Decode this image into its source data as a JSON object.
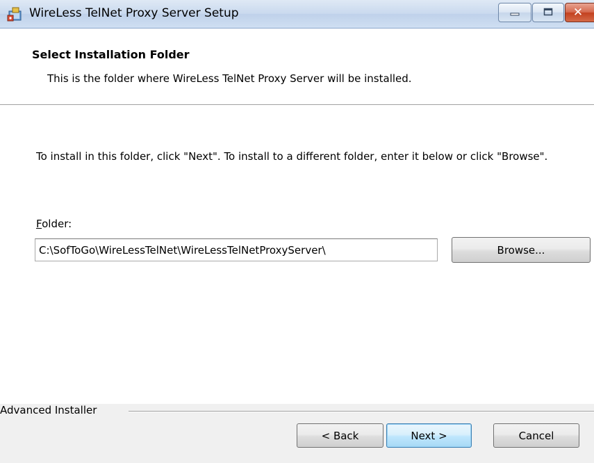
{
  "window": {
    "title": "WireLess TelNet Proxy Server Setup",
    "icons": {
      "app": "installer-icon",
      "minimize": "minimize-icon",
      "maximize": "maximize-icon",
      "close": "close-icon"
    }
  },
  "header": {
    "title": "Select Installation Folder",
    "description": "This is the folder where WireLess TelNet Proxy Server will be installed."
  },
  "main": {
    "instructions": "To install in this folder, click \"Next\". To install to a different folder, enter it below or click \"Browse\".",
    "folder_label_accel": "F",
    "folder_label_rest": "older:",
    "folder_value": "C:\\SofToGo\\WireLessTelNet\\WireLessTelNetProxyServer\\",
    "browse_label": "Browse..."
  },
  "footer": {
    "brand": "Advanced Installer",
    "back_label": "< Back",
    "next_label": "Next >",
    "cancel_label": "Cancel"
  },
  "colors": {
    "close_button": "#c3411f",
    "default_button_border": "#3c7fb1",
    "dialog_background": "#f0f0f0"
  }
}
